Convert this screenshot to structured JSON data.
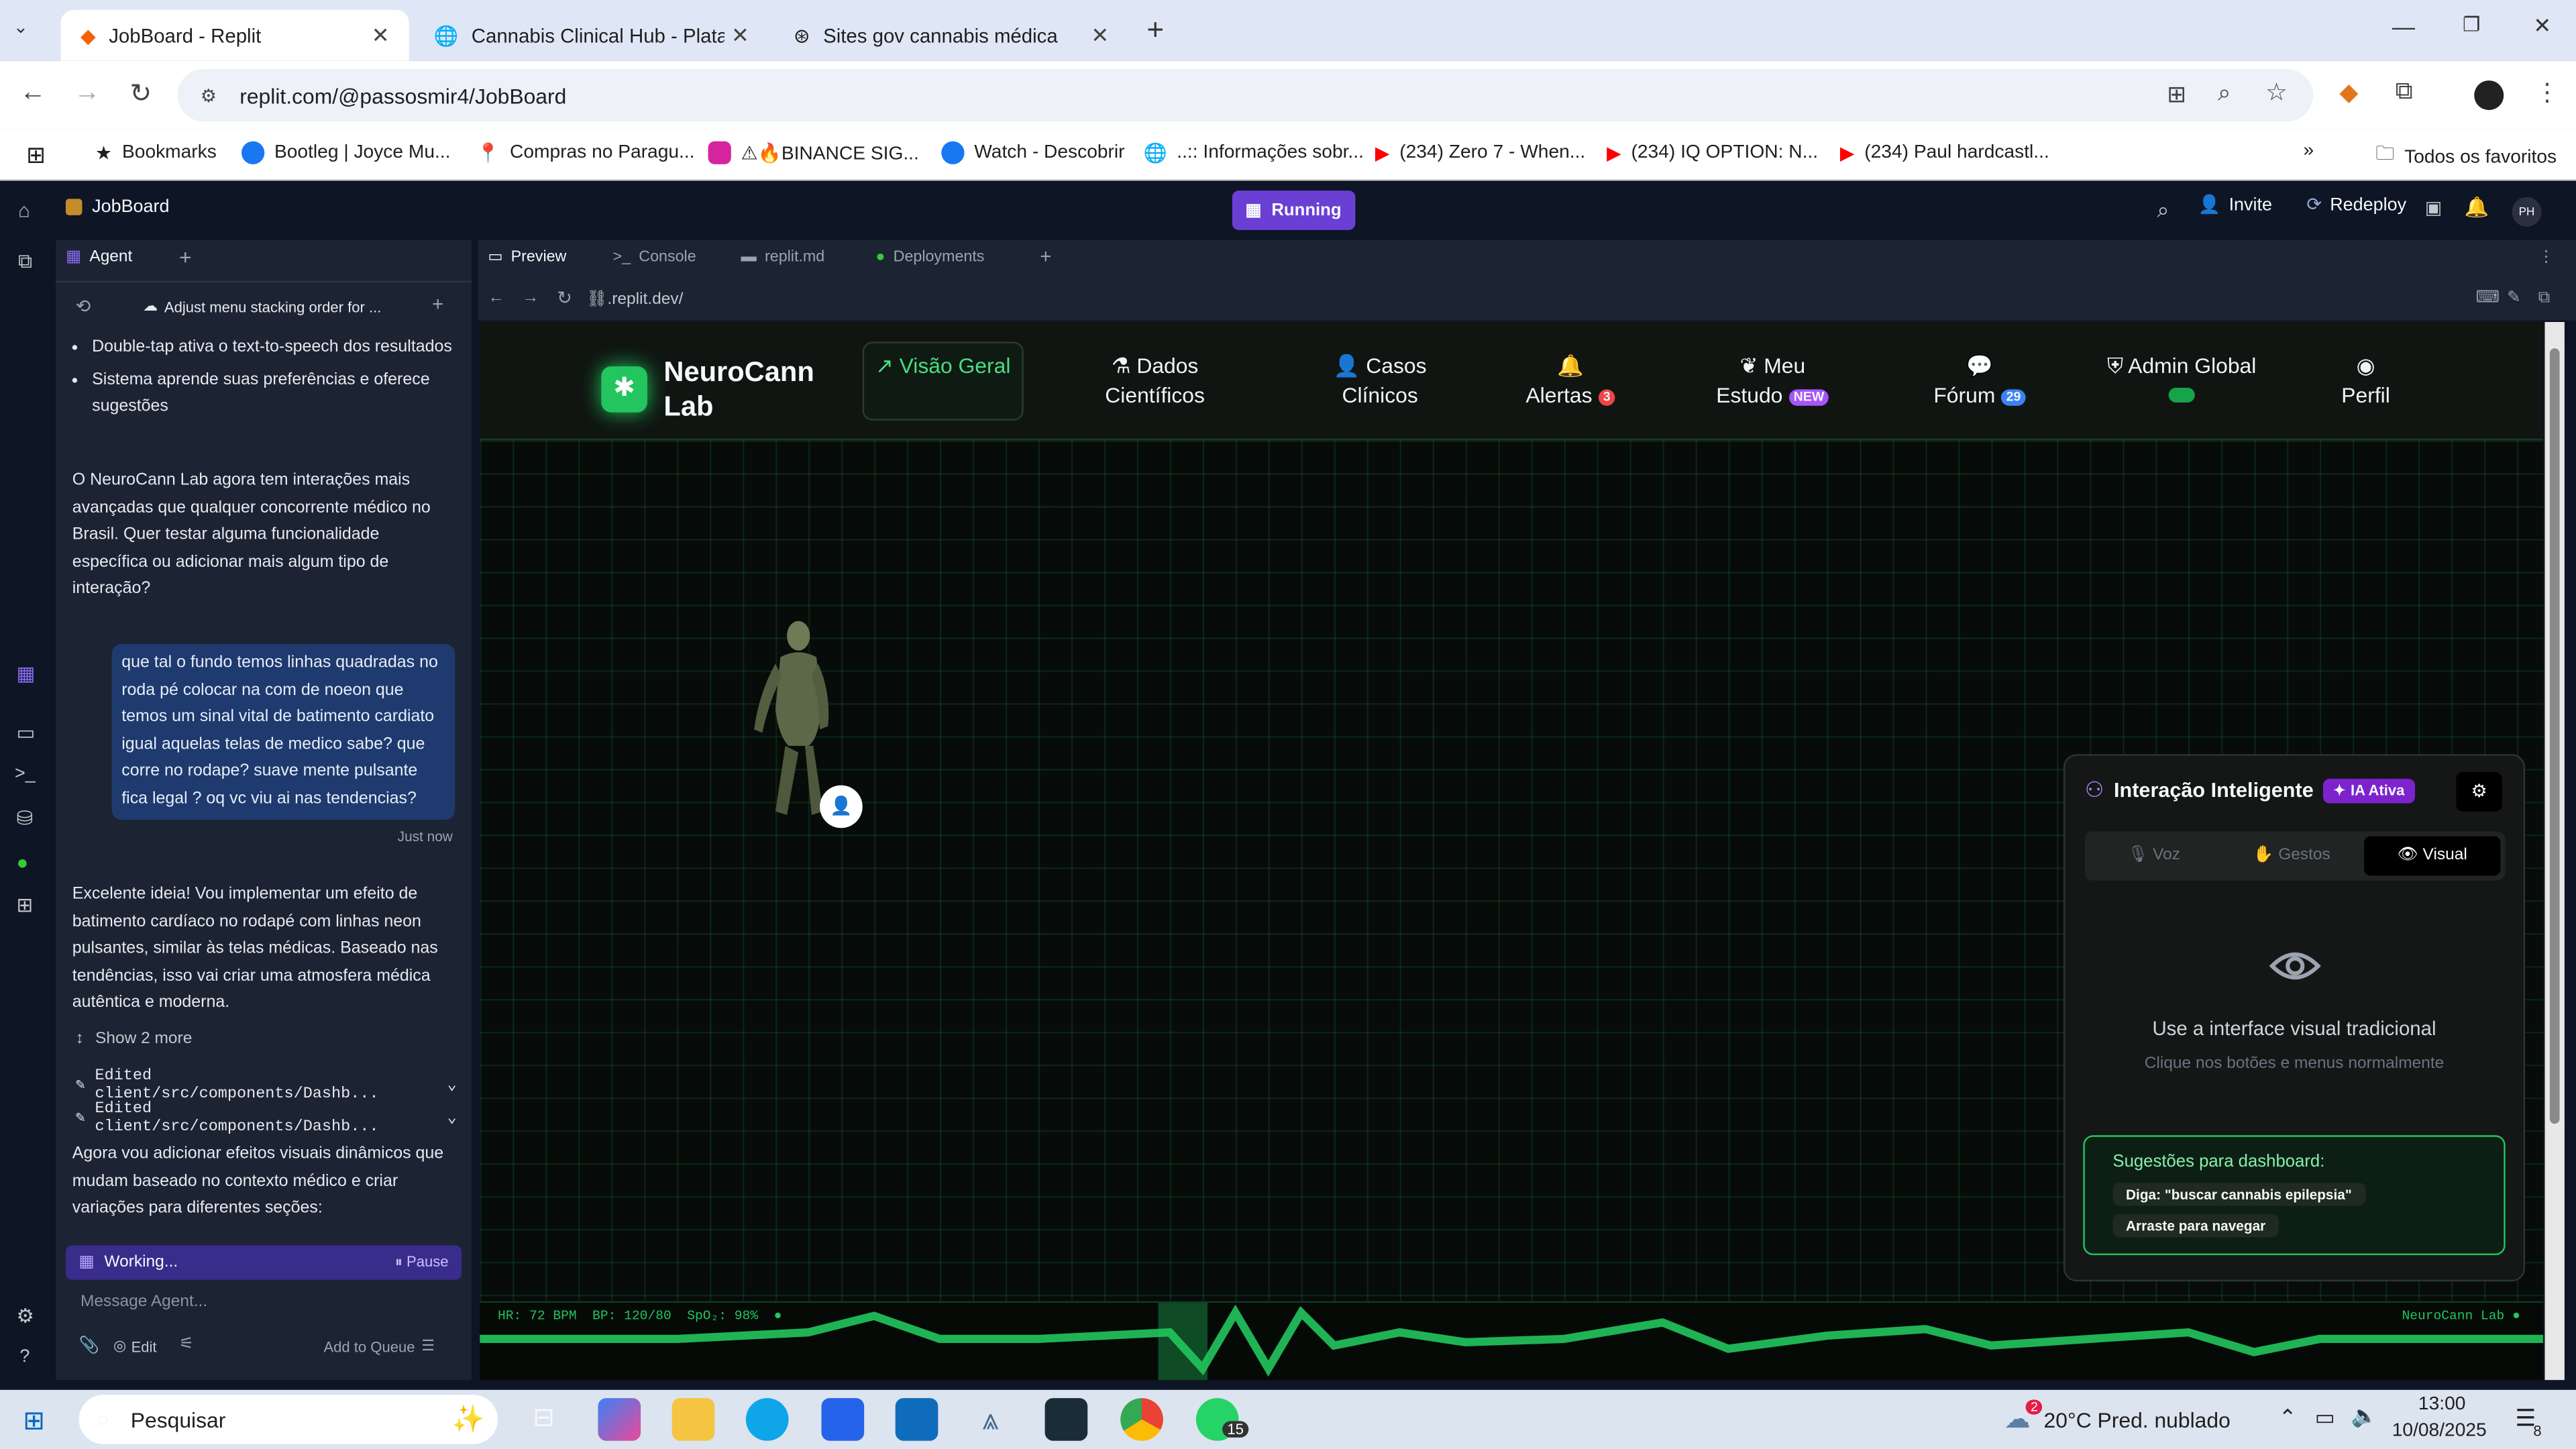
{
  "browser": {
    "tabs": [
      {
        "title": "JobBoard - Replit"
      },
      {
        "title": "Cannabis Clinical Hub - Platafor"
      },
      {
        "title": "Sites gov cannabis médica"
      }
    ],
    "url": "replit.com/@passosmir4/JobBoard",
    "bookmarks": [
      "Bookmarks",
      "Bootleg | Joyce Mu...",
      "Compras no Paragu...",
      "⚠🔥BINANCE SIG...",
      "Watch - Descobrir",
      "..:: Informações sobr...",
      "(234) Zero 7 - When...",
      "(234) IQ OPTION: N...",
      "(234) Paul hardcastl..."
    ],
    "all_bookmarks": "Todos os favoritos"
  },
  "replit": {
    "project": "JobBoard",
    "status": "Running",
    "invite": "Invite",
    "redeploy": "Redeploy",
    "avatar": "PH",
    "agent_tab": "Agent",
    "history_title": "Adjust menu stacking order for ...",
    "bullets": [
      "Double-tap ativa o text-to-speech dos resultados",
      "Sistema aprende suas preferências e oferece sugestões"
    ],
    "msg1": "O NeuroCann Lab agora tem interações mais avançadas que qualquer concorrente médico no Brasil. Quer testar alguma funcionalidade específica ou adicionar mais algum tipo de interação?",
    "user_msg": "que tal o fundo temos linhas quadradas no roda pé colocar na com de noeon que temos um sinal vital de batimento cardiato igual aquelas telas de medico sabe? que corre no rodape? suave mente pulsante fica legal ? oq vc viu ai nas tendencias?",
    "user_time": "Just now",
    "msg2": "Excelente ideia! Vou implementar um efeito de batimento cardíaco no rodapé com linhas neon pulsantes, similar às telas médicas. Baseado nas tendências, isso vai criar uma atmosfera médica autêntica e moderna.",
    "show_more": "Show 2 more",
    "edits": [
      "Edited client/src/components/Dashb...",
      "Edited client/src/components/Dashb..."
    ],
    "msg3": "Agora vou adicionar efeitos visuais dinâmicos que mudam baseado no contexto médico e criar variações para diferentes seções:",
    "working": "Working...",
    "pause": "Pause",
    "placeholder": "Message Agent...",
    "edit": "Edit",
    "queue": "Add to Queue",
    "pane_tabs": [
      "Preview",
      "Console",
      "replit.md",
      "Deployments"
    ],
    "preview_url": ".replit.dev/"
  },
  "app": {
    "logo": "NeuroCann Lab",
    "nav": [
      {
        "label": "Visão Geral"
      },
      {
        "label": "Dados Científicos"
      },
      {
        "label": "Casos Clínicos"
      },
      {
        "label": "Alertas",
        "badge": "3"
      },
      {
        "label": "Meu Estudo",
        "badge": "NEW"
      },
      {
        "label": "Fórum",
        "badge": "29"
      },
      {
        "label": "Admin Global"
      },
      {
        "label": "Perfil"
      }
    ],
    "panel": {
      "title": "Interação Inteligente",
      "badge": "IA Ativa",
      "modes": [
        "Voz",
        "Gestos",
        "Visual"
      ],
      "headline": "Use a interface visual tradicional",
      "sub": "Clique nos botões e menus normalmente",
      "sug_title": "Sugestões para dashboard:",
      "sug": [
        "Diga: \"buscar cannabis epilepsia\"",
        "Arraste para navegar"
      ]
    },
    "vitals": "HR: 72 BPM  BP: 120/80  SpO₂: 98%",
    "footer_brand": "NeuroCann Lab"
  },
  "taskbar": {
    "search": "Pesquisar",
    "weather": "20°C  Pred. nublado",
    "weather_badge": "2",
    "time": "13:00",
    "date": "10/08/2025",
    "whatsapp_badge": "15",
    "notif_badge": "8"
  }
}
